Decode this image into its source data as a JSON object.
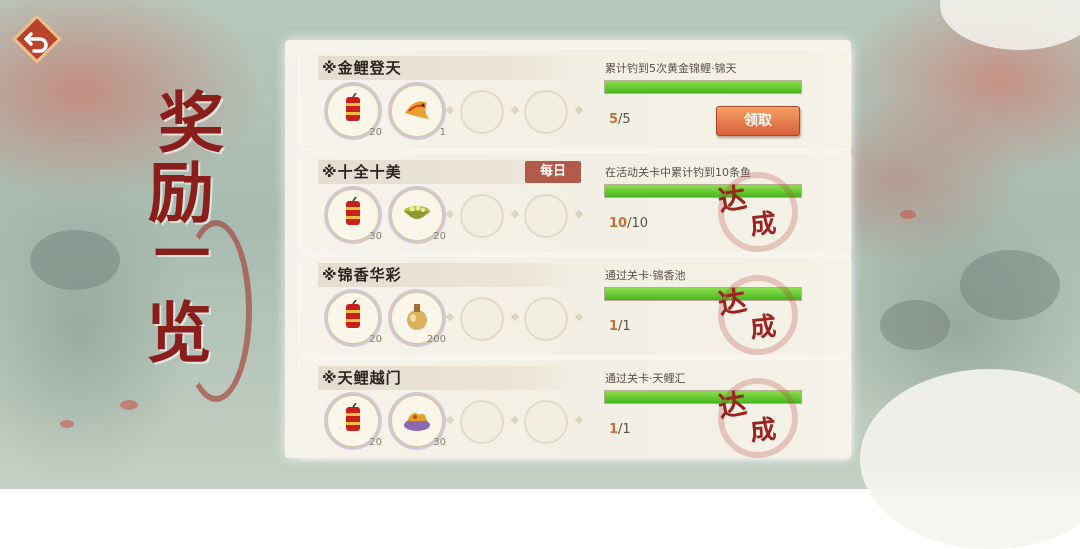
{
  "page_title": [
    "奖",
    "励",
    "一",
    "览"
  ],
  "tasks": [
    {
      "name": "※金鲤登天",
      "daily": "",
      "description": "累计钓到5次黄金锦鲤·锦天",
      "progress_current": "5",
      "progress_total": "/5",
      "progress_fraction": 1.0,
      "rewards": [
        {
          "icon": "firecracker-icon",
          "count": "20"
        },
        {
          "icon": "golden-koi-icon",
          "count": "1"
        }
      ],
      "status": "claim",
      "claim_label": "领取"
    },
    {
      "name": "※十全十美",
      "daily": "每日",
      "description": "在活动关卡中累计钓到10条鱼",
      "progress_current": "10",
      "progress_total": "/10",
      "progress_fraction": 1.0,
      "rewards": [
        {
          "icon": "firecracker-icon",
          "count": "30"
        },
        {
          "icon": "jade-bowl-icon",
          "count": "20"
        }
      ],
      "status": "done",
      "done_label": [
        "达",
        "成"
      ]
    },
    {
      "name": "※锦香华彩",
      "daily": "",
      "description": "通过关卡·锦香池",
      "progress_current": "1",
      "progress_total": "/1",
      "progress_fraction": 1.0,
      "rewards": [
        {
          "icon": "firecracker-icon",
          "count": "20"
        },
        {
          "icon": "gourd-bottle-icon",
          "count": "200"
        }
      ],
      "status": "done",
      "done_label": [
        "达",
        "成"
      ]
    },
    {
      "name": "※天鲤越门",
      "daily": "",
      "description": "通过关卡·天鲤汇",
      "progress_current": "1",
      "progress_total": "/1",
      "progress_fraction": 1.0,
      "rewards": [
        {
          "icon": "firecracker-icon",
          "count": "20"
        },
        {
          "icon": "fried-dish-icon",
          "count": "30"
        }
      ],
      "status": "done",
      "done_label": [
        "达",
        "成"
      ]
    }
  ],
  "colors": {
    "accent_red": "#9c2420",
    "progress_green": "#49b520",
    "claim_orange": "#d8603a"
  }
}
